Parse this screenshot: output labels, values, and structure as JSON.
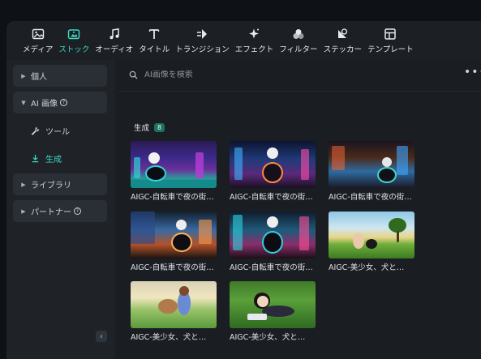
{
  "toolbar": {
    "items": [
      {
        "label": "メディア",
        "icon": "media-icon",
        "active": false
      },
      {
        "label": "ストック",
        "icon": "stock-icon",
        "active": true
      },
      {
        "label": "オーディオ",
        "icon": "music-note-icon",
        "active": false
      },
      {
        "label": "タイトル",
        "icon": "text-t-icon",
        "active": false
      },
      {
        "label": "トランジション",
        "icon": "transition-icon",
        "active": false
      },
      {
        "label": "エフェクト",
        "icon": "sparkle-icon",
        "active": false
      },
      {
        "label": "フィルター",
        "icon": "filter-icon",
        "active": false
      },
      {
        "label": "ステッカー",
        "icon": "sticker-icon",
        "active": false
      },
      {
        "label": "テンプレート",
        "icon": "template-icon",
        "active": false
      }
    ]
  },
  "sidebar": {
    "personal": "個人",
    "ai_image": "AI 画像",
    "tool": "ツール",
    "generate": "生成",
    "library": "ライブラリ",
    "partner": "パートナー",
    "help_glyph": "?",
    "collapse_glyph": "‹"
  },
  "search": {
    "placeholder": "AI画像を検索",
    "value": ""
  },
  "more_glyph": "•••",
  "section": {
    "title": "生成",
    "count": "8"
  },
  "items": [
    {
      "label": "AIGC-自転車で夜の街…",
      "scene": "city-panda-bike"
    },
    {
      "label": "AIGC-自転車で夜の街…",
      "scene": "city-panda-moto"
    },
    {
      "label": "AIGC-自転車で夜の街…",
      "scene": "city-rider"
    },
    {
      "label": "AIGC-自転車で夜の街…",
      "scene": "city-panda-bike-2"
    },
    {
      "label": "AIGC-自転車で夜の街…",
      "scene": "city-panda-neon"
    },
    {
      "label": "AIGC-美少女、犬と…",
      "scene": "girl-dog-meadow"
    },
    {
      "label": "AIGC-美少女、犬と…",
      "scene": "girl-dog-field"
    },
    {
      "label": "AIGC-美少女、犬と…",
      "scene": "girl-grass"
    }
  ],
  "colors": {
    "accent": "#3fd7c3",
    "background": "#1a1d22",
    "sidebar": "#1f2328",
    "badge": "#1d6f62"
  }
}
